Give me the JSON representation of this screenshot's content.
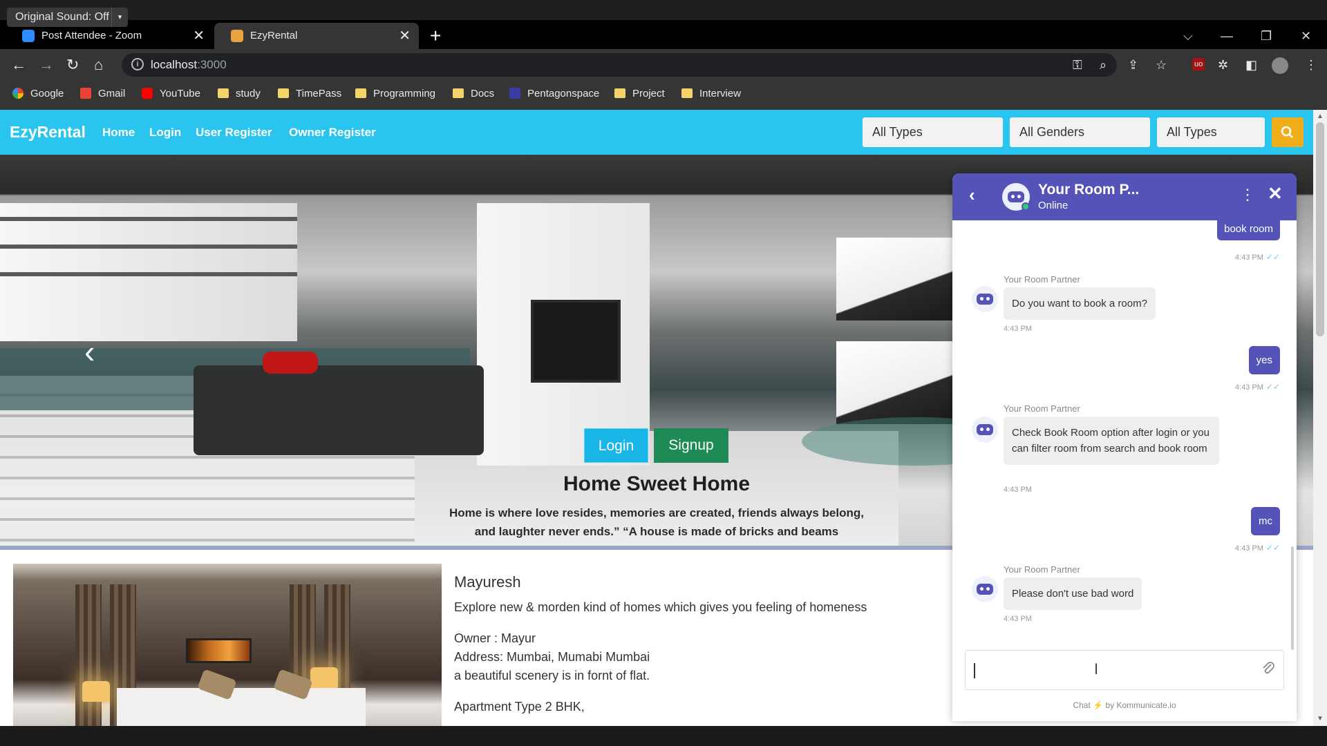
{
  "zoom_overlay": {
    "sound_label": "Original Sound: Off",
    "caret": "▾"
  },
  "browser": {
    "tabs": [
      {
        "title": "Post Attendee - Zoom",
        "close": "✕",
        "icon_color": "#2d8cff"
      },
      {
        "title": "EzyRental",
        "close": "✕",
        "icon_color": "#e8a33c"
      }
    ],
    "new_tab": "+",
    "window_controls": {
      "tab_search": "⌵",
      "minimize": "—",
      "restore": "❐",
      "close": "✕"
    },
    "nav": {
      "back": "←",
      "forward": "→",
      "reload": "↻",
      "home": "⌂"
    },
    "address": {
      "host": "localhost",
      "port": ":3000",
      "info": "i"
    },
    "extensions": {
      "key": "⚿",
      "zoom": "⌕",
      "share": "⇪",
      "star": "☆",
      "ublock": "uo",
      "puzzle": "✲",
      "sidepanel": "◧",
      "menu": "⋮"
    },
    "bookmarks": [
      "Google",
      "Gmail",
      "YouTube",
      "study",
      "TimePass",
      "Programming",
      "Docs",
      "Pentagonspace",
      "Project",
      "Interview"
    ]
  },
  "site": {
    "brand": "EzyRental",
    "nav_links": [
      "Home",
      "Login",
      "User Register",
      "Owner Register"
    ],
    "filters": [
      "All Types",
      "All Genders",
      "All Types"
    ],
    "search_icon": "search-icon",
    "hero": {
      "prev": "‹",
      "login_label": "Login",
      "signup_label": "Signup",
      "title": "Home Sweet Home",
      "text_line1": "Home is where love resides, memories are created, friends always belong,",
      "text_line2": "and laughter never ends.” “A house is made of bricks and beams",
      "active_slide": 2,
      "slide_count": 3
    },
    "listing": {
      "name": "Mayuresh",
      "tagline": "Explore new & morden kind of homes which gives you feeling of homeness",
      "owner": "Owner : Mayur",
      "address": "Address: Mumbai, Mumabi Mumbai",
      "description": "a beautiful scenery is in fornt of flat.",
      "apartment": "Apartment Type 2 BHK,"
    }
  },
  "chat": {
    "title": "Your Room P...",
    "status": "Online",
    "back": "‹",
    "menu": "⋮",
    "close": "✕",
    "messages": [
      {
        "from": "user",
        "text": "book room",
        "time": "4:43 PM"
      },
      {
        "from": "bot",
        "sender": "Your Room Partner",
        "text": "Do you want to book a room?",
        "time": "4:43 PM"
      },
      {
        "from": "user",
        "text": "yes",
        "time": "4:43 PM"
      },
      {
        "from": "bot",
        "sender": "Your Room Partner",
        "text": "Check Book Room option after login or you can filter room from search and book room",
        "time": "4:43 PM"
      },
      {
        "from": "user",
        "text": "mc",
        "time": "4:43 PM"
      },
      {
        "from": "bot",
        "sender": "Your Room Partner",
        "text": "Please don't use bad word",
        "time": "4:43 PM"
      }
    ],
    "ticks": "✓✓",
    "input_value": "",
    "attach_icon": "paperclip-icon",
    "powered_prefix": "Chat",
    "powered_bolt": "⚡",
    "powered_suffix": "by Kommunicate.io",
    "accent": "#5553b7"
  },
  "colors": {
    "site_nav": "#29c5ee",
    "search_btn": "#f0ad1b",
    "login_btn": "#18b5e6",
    "signup_btn": "#1e8a56"
  }
}
